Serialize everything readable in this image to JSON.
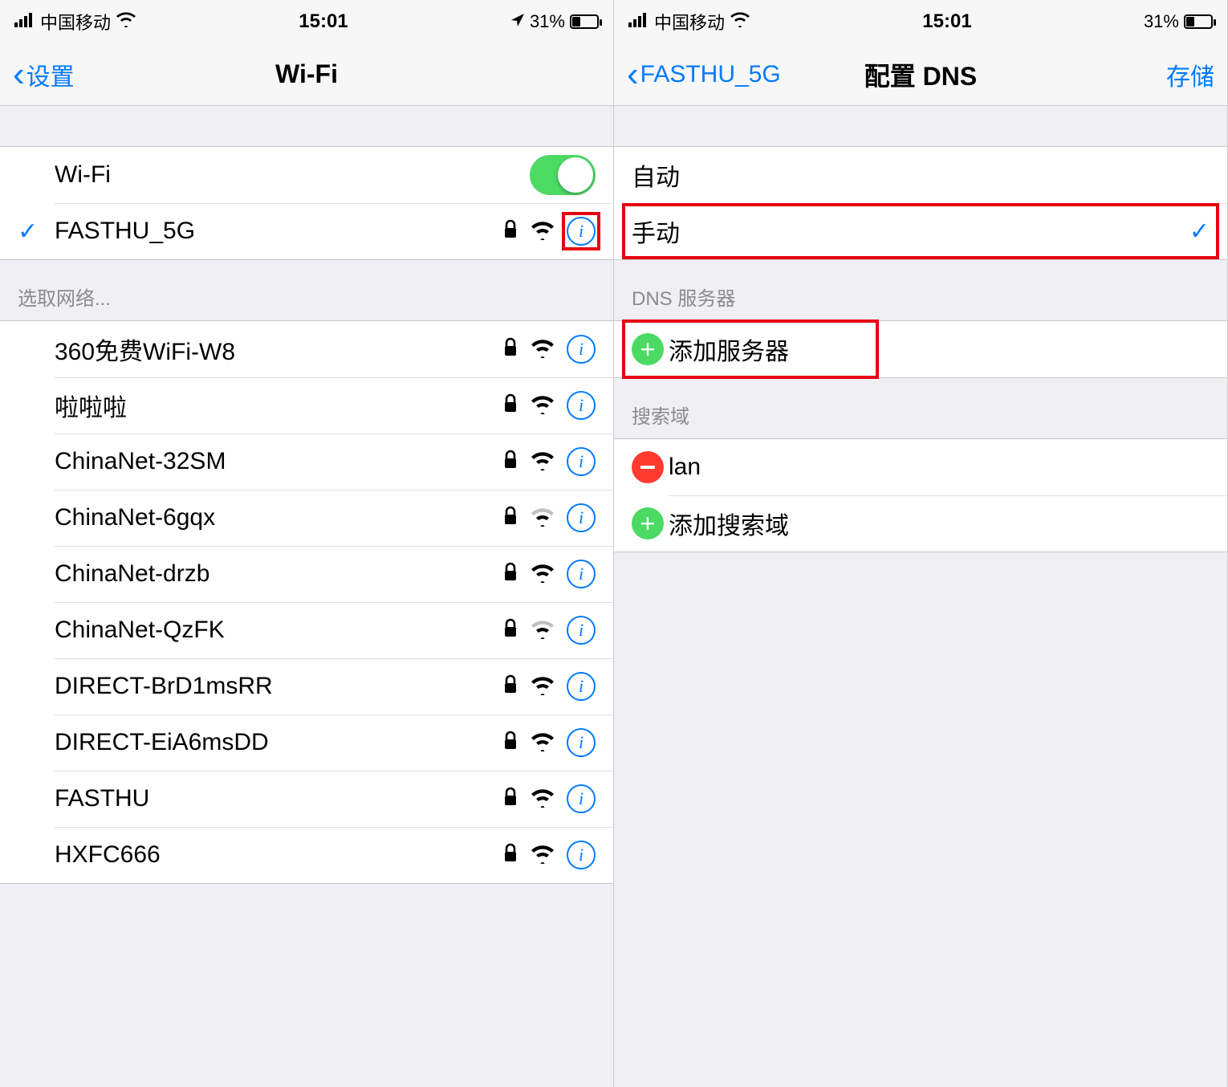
{
  "left": {
    "status": {
      "carrier": "中国移动",
      "time": "15:01",
      "battery": "31%"
    },
    "nav": {
      "back": "设置",
      "title": "Wi-Fi"
    },
    "wifi_row_label": "Wi-Fi",
    "connected": {
      "name": "FASTHU_5G"
    },
    "choose_header": "选取网络...",
    "networks": [
      {
        "name": "360免费WiFi-W8",
        "weak": false
      },
      {
        "name": "啦啦啦",
        "weak": false
      },
      {
        "name": "ChinaNet-32SM",
        "weak": false
      },
      {
        "name": "ChinaNet-6gqx",
        "weak": true
      },
      {
        "name": "ChinaNet-drzb",
        "weak": false
      },
      {
        "name": "ChinaNet-QzFK",
        "weak": true
      },
      {
        "name": "DIRECT-BrD1msRR",
        "weak": false
      },
      {
        "name": "DIRECT-EiA6msDD",
        "weak": false
      },
      {
        "name": "FASTHU",
        "weak": false
      },
      {
        "name": "HXFC666",
        "weak": false
      }
    ]
  },
  "right": {
    "status": {
      "carrier": "中国移动",
      "time": "15:01",
      "battery": "31%"
    },
    "nav": {
      "back": "FASTHU_5G",
      "title": "配置 DNS",
      "save": "存储"
    },
    "mode": {
      "auto": "自动",
      "manual": "手动"
    },
    "dns_header": "DNS 服务器",
    "dns_add": "添加服务器",
    "search_header": "搜索域",
    "search_domain": "lan",
    "search_add": "添加搜索域"
  }
}
